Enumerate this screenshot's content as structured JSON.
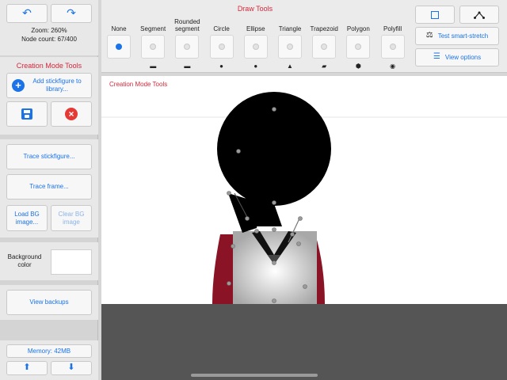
{
  "sidebar": {
    "zoom_text": "Zoom: 260%",
    "node_count_text": "Node count: 67/400",
    "section_title": "Creation Mode Tools",
    "add_to_library_label": "Add stickfigure to library...",
    "trace_stickfigure_label": "Trace stickfigure...",
    "trace_frame_label": "Trace frame...",
    "load_bg_label": "Load BG image...",
    "clear_bg_label": "Clear BG image",
    "background_color_label": "Background color",
    "background_color_value": "#ffffff",
    "view_backups_label": "View backups",
    "memory_label": "Memory: 42MB"
  },
  "toolbar": {
    "title": "Draw Tools",
    "tools": [
      {
        "label": "None",
        "glyph": "",
        "selected": true
      },
      {
        "label": "Segment",
        "glyph": "▬",
        "selected": false
      },
      {
        "label": "Rounded segment",
        "glyph": "▬",
        "selected": false
      },
      {
        "label": "Circle",
        "glyph": "●",
        "selected": false
      },
      {
        "label": "Ellipse",
        "glyph": "●",
        "selected": false
      },
      {
        "label": "Triangle",
        "glyph": "▲",
        "selected": false
      },
      {
        "label": "Trapezoid",
        "glyph": "▰",
        "selected": false
      },
      {
        "label": "Polygon",
        "glyph": "⬢",
        "selected": false
      },
      {
        "label": "Polyfill",
        "glyph": "◉",
        "selected": false
      }
    ],
    "test_smart_stretch_label": "Test smart-stretch",
    "view_options_label": "View options"
  },
  "canvas": {
    "title": "Creation Mode Tools"
  },
  "colors": {
    "accent": "#1a73e8",
    "title_red": "#d6273a",
    "cancel_red": "#e53935",
    "figure_black": "#000000",
    "shirt_gray": "#c8c8c8",
    "jacket_maroon": "#8a1426"
  }
}
